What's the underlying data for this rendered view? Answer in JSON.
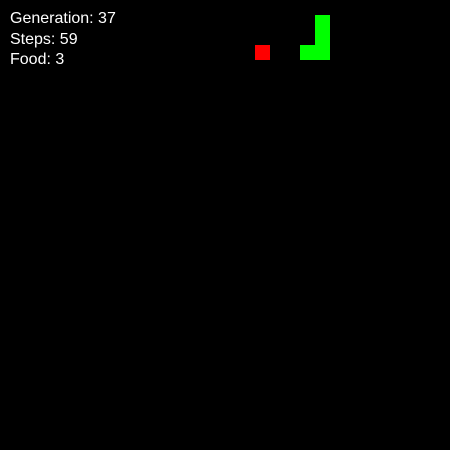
{
  "hud": {
    "generation_text": "Generation: 37",
    "steps_text": "Steps: 59",
    "food_text": "Food: 3"
  },
  "colors": {
    "background": "#000000",
    "snake": "#00ff00",
    "food": "#ff0000",
    "text": "#ffffff"
  }
}
